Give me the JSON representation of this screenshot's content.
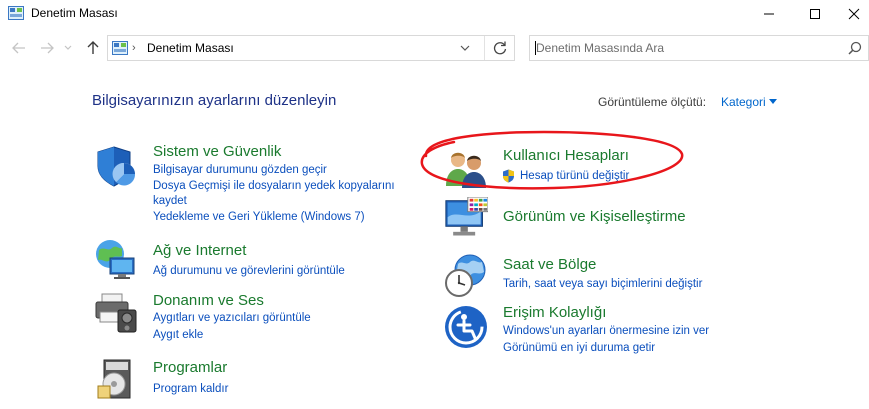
{
  "window": {
    "title": "Denetim Masası",
    "icon": "control-panel-icon",
    "controls": [
      "minimize-icon",
      "maximize-icon",
      "close-icon"
    ]
  },
  "navigation": {
    "address": "Denetim Masası",
    "search_placeholder": "Denetim Masasında Ara"
  },
  "main": {
    "heading": "Bilgisayarınızın ayarlarını düzenleyin",
    "view_by_label": "Görüntüleme ölçütü:",
    "view_by_value": "Kategori"
  },
  "categories_left": [
    {
      "title": "Sistem ve Güvenlik",
      "icon": "shield-icon",
      "links": [
        "Bilgisayar durumunu gözden geçir",
        "Dosya Geçmişi ile dosyaların yedek kopyalarını",
        "kaydet",
        "Yedekleme ve Geri Yükleme (Windows 7)"
      ]
    },
    {
      "title": "Ağ ve Internet",
      "icon": "network-globe-icon",
      "links": [
        "Ağ durumunu ve görevlerini görüntüle"
      ]
    },
    {
      "title": "Donanım ve Ses",
      "icon": "printer-speaker-icon",
      "links": [
        "Aygıtları ve yazıcıları görüntüle",
        "Aygıt ekle"
      ]
    },
    {
      "title": "Programlar",
      "icon": "programs-disc-icon",
      "links": [
        "Program kaldır"
      ]
    }
  ],
  "categories_right": [
    {
      "title": "Kullanıcı Hesapları",
      "icon": "users-icon",
      "links": [
        "Hesap türünü değiştir"
      ],
      "link_icon": "uac-shield-icon"
    },
    {
      "title": "Görünüm ve Kişiselleştirme",
      "icon": "monitor-palette-icon",
      "links": []
    },
    {
      "title": "Saat ve Bölge",
      "icon": "clock-globe-icon",
      "links": [
        "Tarih, saat veya sayı biçimlerini değiştir"
      ]
    },
    {
      "title": "Erişim Kolaylığı",
      "icon": "accessibility-icon",
      "links": [
        "Windows'un ayarları önermesine izin ver",
        "Görünümü en iyi duruma getir"
      ]
    }
  ],
  "annotation": {
    "type": "red-hand-drawn-circle",
    "color": "#e8161b"
  }
}
